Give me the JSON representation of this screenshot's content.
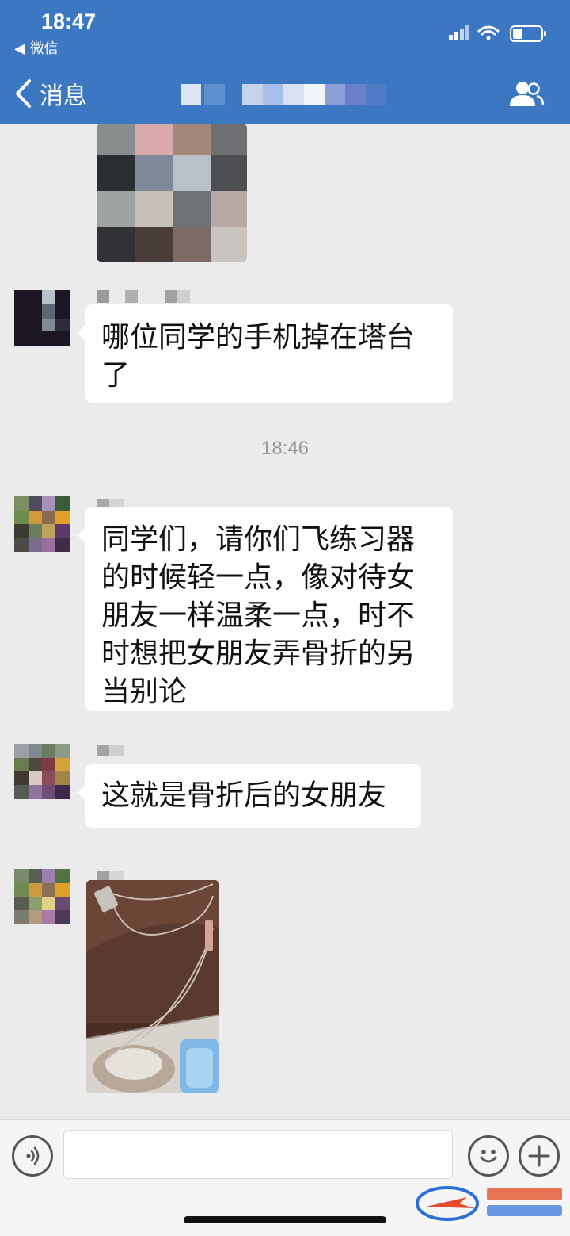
{
  "status_bar": {
    "time": "18:47",
    "back_app": "◀ 微信"
  },
  "nav": {
    "back_label": "消息",
    "title": ""
  },
  "messages": [
    {
      "type": "text",
      "text": "哪位同学的手机掉在塔台了"
    },
    {
      "type": "timestamp",
      "text": "18:46"
    },
    {
      "type": "text",
      "text": "同学们，请你们飞练习器的时候轻一点，像对待女朋友一样温柔一点，时不时想把女朋友弄骨折的另当别论"
    },
    {
      "type": "text",
      "text": "这就是骨折后的女朋友"
    },
    {
      "type": "image"
    }
  ],
  "input": {
    "placeholder": ""
  },
  "colors": {
    "nav_bg": "#3c78c1",
    "chat_bg": "#ebebeb",
    "bubble_bg": "#ffffff"
  },
  "icons": [
    "back-icon",
    "group-icon",
    "voice-icon",
    "emoji-icon",
    "plus-icon",
    "signal-icon",
    "wifi-icon",
    "battery-icon"
  ]
}
